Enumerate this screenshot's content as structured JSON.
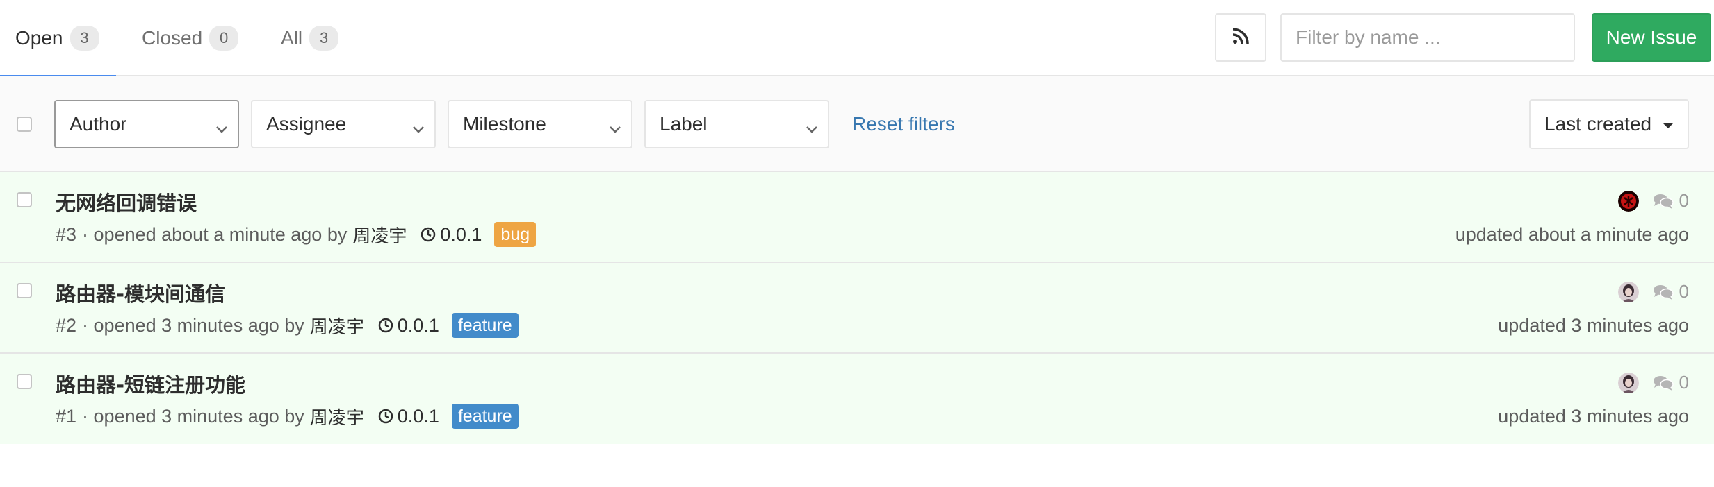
{
  "tabs": [
    {
      "label": "Open",
      "count": "3"
    },
    {
      "label": "Closed",
      "count": "0"
    },
    {
      "label": "All",
      "count": "3"
    }
  ],
  "header": {
    "rss_icon": "rss-icon",
    "filter_placeholder": "Filter by name ...",
    "new_issue_label": "New Issue"
  },
  "filters": {
    "author": "Author",
    "assignee": "Assignee",
    "milestone": "Milestone",
    "label": "Label",
    "reset": "Reset filters",
    "sort": "Last created"
  },
  "colors": {
    "accent_green": "#2faa60",
    "tab_underline": "#4a8bee",
    "link_blue": "#3777b0",
    "label_bug": "#eea543",
    "label_feature": "#428bca",
    "row_background": "#f3fef3"
  },
  "issues": [
    {
      "title": "无网络回调错误",
      "ref": "#3",
      "opened": "· opened about a minute ago by",
      "author": "周凌宇",
      "milestone": "0.0.1",
      "label": "bug",
      "label_color": "#eea543",
      "comments": "0",
      "updated": "updated about a minute ago",
      "avatar": "avatar-red"
    },
    {
      "title": "路由器-模块间通信",
      "ref": "#2",
      "opened": "· opened 3 minutes ago by",
      "author": "周凌宇",
      "milestone": "0.0.1",
      "label": "feature",
      "label_color": "#428bca",
      "comments": "0",
      "updated": "updated 3 minutes ago",
      "avatar": "avatar-photo"
    },
    {
      "title": "路由器-短链注册功能",
      "ref": "#1",
      "opened": "· opened 3 minutes ago by",
      "author": "周凌宇",
      "milestone": "0.0.1",
      "label": "feature",
      "label_color": "#428bca",
      "comments": "0",
      "updated": "updated 3 minutes ago",
      "avatar": "avatar-photo"
    }
  ]
}
